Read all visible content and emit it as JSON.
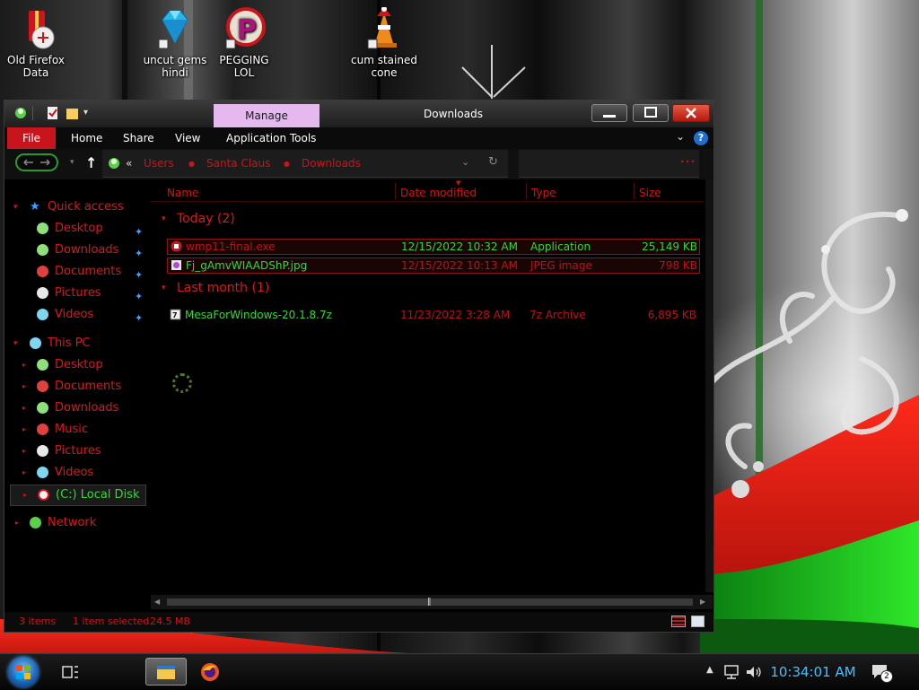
{
  "desktop": {
    "icons": [
      {
        "label": "Old Firefox Data",
        "icon": "gift-icon"
      },
      {
        "label": "uncut gems hindi",
        "icon": "diamond-icon"
      },
      {
        "label": "PEGGING LOL",
        "icon": "p-logo-icon"
      },
      {
        "label": "cum stained cone",
        "icon": "traffic-cone-icon"
      }
    ]
  },
  "window": {
    "title": "Downloads",
    "contextual_tab": "Manage",
    "ribbon_tabs": [
      "File",
      "Home",
      "Share",
      "View",
      "Application Tools"
    ],
    "breadcrumb": [
      "Users",
      "Santa Claus",
      "Downloads"
    ],
    "breadcrumb_overflow": "«",
    "nav": {
      "quick_access": {
        "label": "Quick access",
        "items": [
          {
            "label": "Desktop",
            "icon": "desktop-folder-icon",
            "pinned": true
          },
          {
            "label": "Downloads",
            "icon": "downloads-folder-icon",
            "pinned": true
          },
          {
            "label": "Documents",
            "icon": "documents-folder-icon",
            "pinned": true
          },
          {
            "label": "Pictures",
            "icon": "pictures-folder-icon",
            "pinned": true
          },
          {
            "label": "Videos",
            "icon": "videos-folder-icon",
            "pinned": true
          }
        ]
      },
      "this_pc": {
        "label": "This PC",
        "items": [
          {
            "label": "Desktop",
            "icon": "desktop-folder-icon"
          },
          {
            "label": "Documents",
            "icon": "documents-folder-icon"
          },
          {
            "label": "Downloads",
            "icon": "downloads-folder-icon"
          },
          {
            "label": "Music",
            "icon": "music-folder-icon"
          },
          {
            "label": "Pictures",
            "icon": "pictures-folder-icon"
          },
          {
            "label": "Videos",
            "icon": "videos-folder-icon"
          },
          {
            "label": "(C:) Local Disk",
            "icon": "disk-icon",
            "selected": true
          }
        ]
      },
      "network": {
        "label": "Network",
        "icon": "network-icon"
      }
    },
    "columns": [
      "Name",
      "Date modified",
      "Type",
      "Size"
    ],
    "groups": [
      {
        "label": "Today (2)",
        "files": [
          {
            "name": "wmp11-final.exe",
            "date": "12/15/2022 10:32 AM",
            "type": "Application",
            "size": "25,149 KB",
            "icon": "exe-icon",
            "selected": true
          },
          {
            "name": "Fj_gAmvWIAADShP.jpg",
            "date": "12/15/2022 10:13 AM",
            "type": "JPEG image",
            "size": "798 KB",
            "icon": "image-file-icon",
            "selected": true
          }
        ]
      },
      {
        "label": "Last month (1)",
        "files": [
          {
            "name": "MesaForWindows-20.1.8.7z",
            "date": "11/23/2022 3:28 AM",
            "type": "7z Archive",
            "size": "6,895 KB",
            "icon": "archive-icon",
            "selected": false
          }
        ]
      }
    ],
    "status": {
      "items": "3 items",
      "selection": "1 item selected",
      "size": "24.5 MB"
    }
  },
  "taskbar": {
    "clock": "10:34:01 AM",
    "notification_count": "2",
    "pinned": [
      "start-orb-icon",
      "task-view-icon",
      "file-explorer-icon",
      "firefox-icon"
    ]
  },
  "colors": {
    "accent_red": "#e0141c",
    "accent_green": "#2fdc2f",
    "manage_tab": "#e6b8f0",
    "clock_blue": "#49c0ff"
  }
}
